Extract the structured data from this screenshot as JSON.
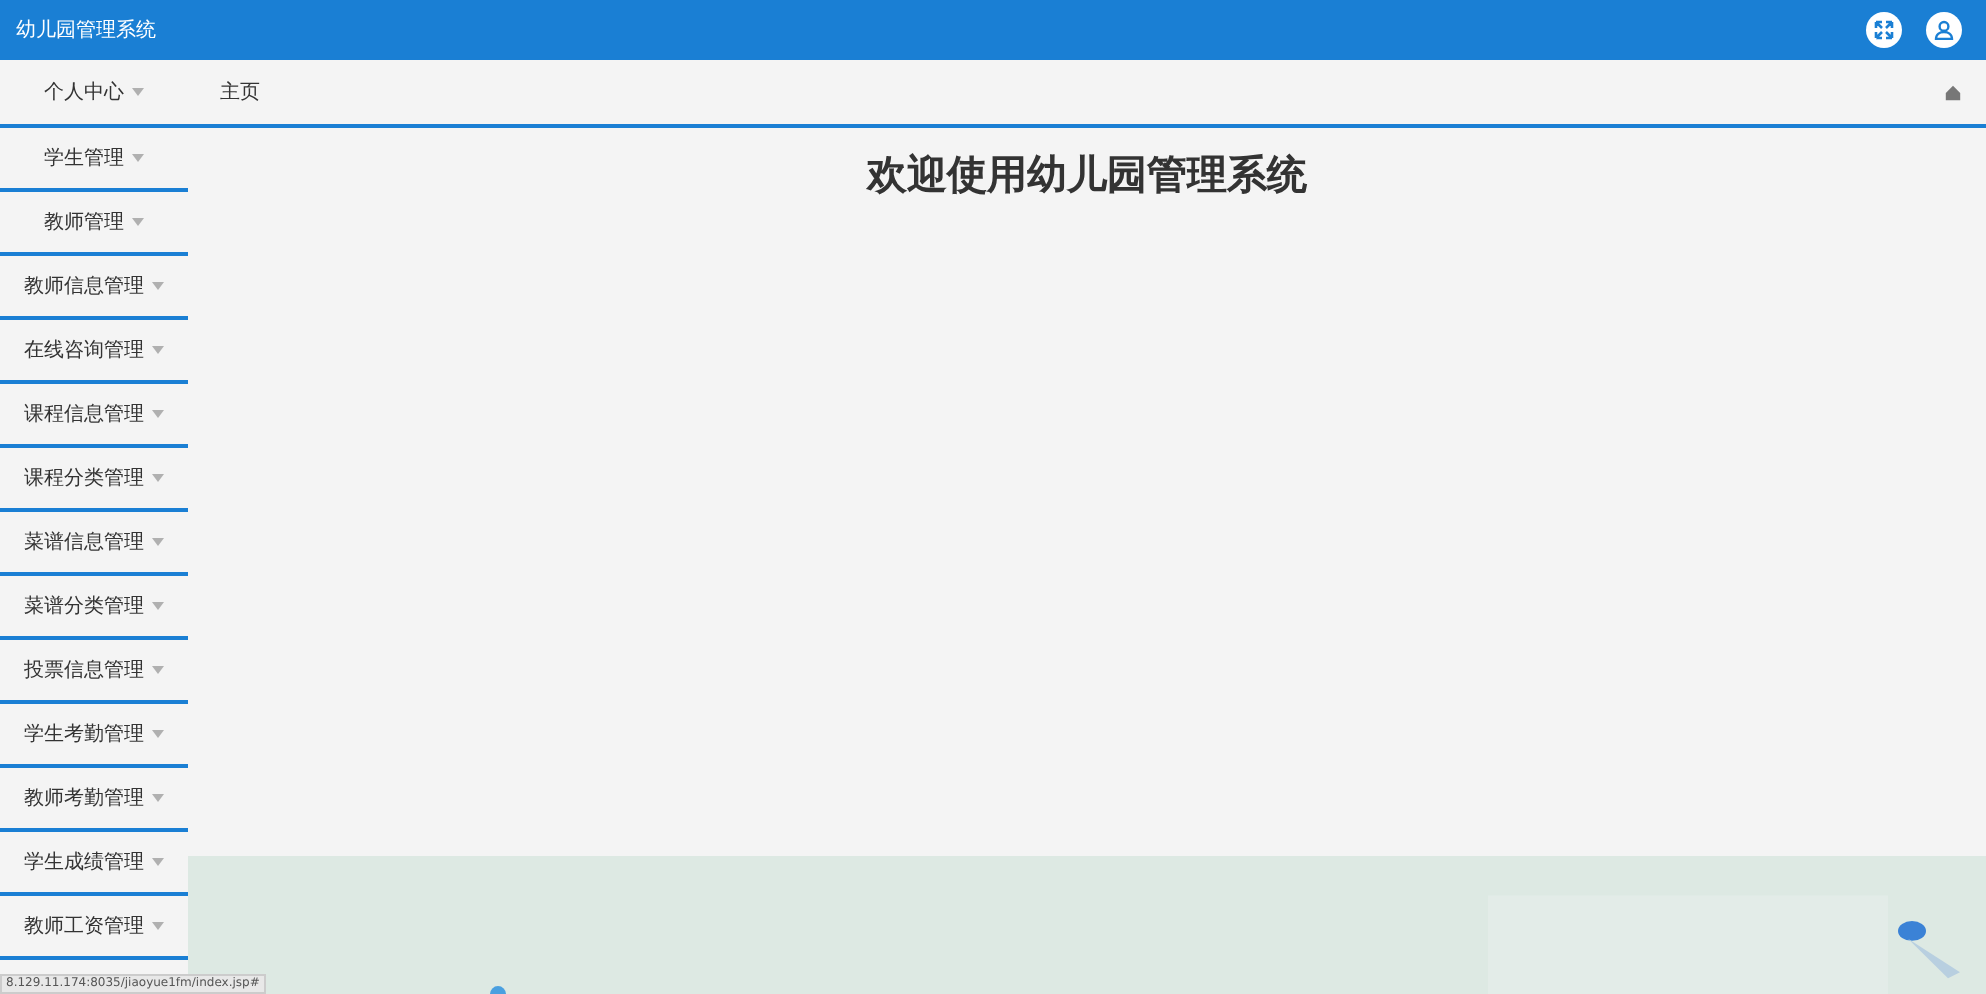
{
  "window": {
    "title": "幼儿园管理系统"
  },
  "sidebar": {
    "items": [
      {
        "label": "个人中心"
      },
      {
        "label": "学生管理"
      },
      {
        "label": "教师管理"
      },
      {
        "label": "教师信息管理"
      },
      {
        "label": "在线咨询管理"
      },
      {
        "label": "课程信息管理"
      },
      {
        "label": "课程分类管理"
      },
      {
        "label": "菜谱信息管理"
      },
      {
        "label": "菜谱分类管理"
      },
      {
        "label": "投票信息管理"
      },
      {
        "label": "学生考勤管理"
      },
      {
        "label": "教师考勤管理"
      },
      {
        "label": "学生成绩管理"
      },
      {
        "label": "教师工资管理"
      }
    ]
  },
  "breadcrumb": "主页",
  "main": {
    "heading": "欢迎使用幼儿园管理系统"
  },
  "status_bar": {
    "url": "8.129.11.174:8035/jiaoyue1fm/index.jsp#"
  }
}
